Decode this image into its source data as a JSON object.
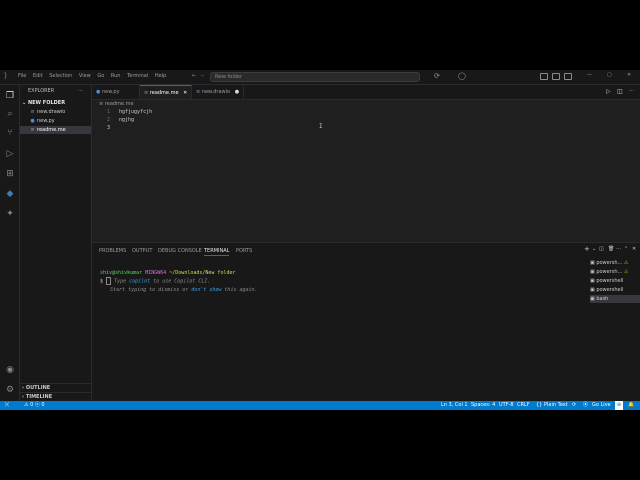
{
  "menu": [
    "File",
    "Edit",
    "Selection",
    "View",
    "Go",
    "Run",
    "Terminal",
    "Help"
  ],
  "command_center": "New folder",
  "sidebar": {
    "title": "EXPLORER",
    "folder": "NEW FOLDER",
    "files": [
      {
        "name": "new.drawio",
        "icon": "≡",
        "icon_color": "#8b8bd6"
      },
      {
        "name": "new.py",
        "icon": "●",
        "icon_color": "#3f8fd6"
      },
      {
        "name": "readme.me",
        "icon": "≡",
        "icon_color": "#9d9d9d"
      }
    ],
    "outline": "OUTLINE",
    "timeline": "TIMELINE"
  },
  "tabs": [
    {
      "label": "new.py",
      "icon": "●",
      "icon_color": "#3f8fd6"
    },
    {
      "label": "readme.me",
      "icon": "≡",
      "icon_color": "#9d9d9d"
    },
    {
      "label": "new.drawio",
      "icon": "≡",
      "icon_color": "#8b8bd6"
    }
  ],
  "breadcrumb": "readme.me",
  "editor": {
    "lines": [
      {
        "num": "1",
        "text": "hgfjugyfcjh"
      },
      {
        "num": "2",
        "text": "ngjhg"
      },
      {
        "num": "3",
        "text": ""
      }
    ]
  },
  "panel": {
    "tabs": [
      "PROBLEMS",
      "OUTPUT",
      "DEBUG CONSOLE",
      "TERMINAL",
      "PORTS"
    ],
    "terminal": {
      "user": "shiv@shivkumar",
      "shell": "MINGW64",
      "path": "~/Downloads/New folder",
      "prompt": "$",
      "hint_part1": "Type",
      "hint_link": "copilot",
      "hint_part2": "to use Copilot CLI.",
      "hint_line2a": "Start typing to dismiss or",
      "hint_link2": "don't show",
      "hint_line2b": "this again."
    },
    "terminal_list": [
      "powersh...",
      "powersh...",
      "powershell",
      "powershell",
      "bash"
    ]
  },
  "status": {
    "left": "⚠ 0  ⓧ 0",
    "position": "Ln 3, Col 1",
    "spaces": "Spaces: 4",
    "encoding": "UTF-8",
    "eol": "CRLF",
    "language": "Plain Text",
    "golive": "Go Live"
  },
  "colors": {
    "accent": "#007acc",
    "prompt_user": "#5fd75f",
    "shell": "#d670d6",
    "path": "#d7d75f"
  }
}
